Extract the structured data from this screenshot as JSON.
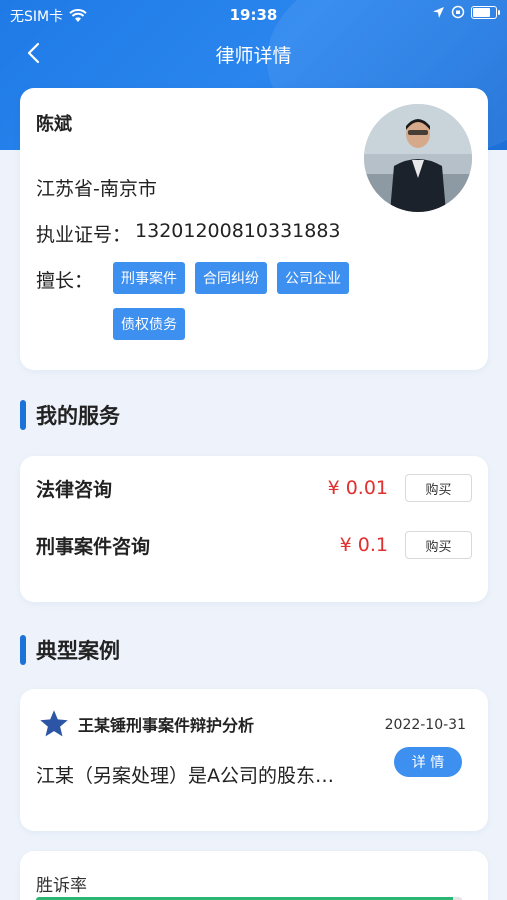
{
  "status_bar": {
    "carrier": "无SIM卡",
    "time": "19:38"
  },
  "nav": {
    "title": "律师详情"
  },
  "profile": {
    "name": "陈斌",
    "location": "江苏省-南京市",
    "license_label": "执业证号：",
    "license_number": "13201200810331883",
    "specialty_label": "擅长：",
    "specialties": [
      "刑事案件",
      "合同纠纷",
      "公司企业",
      "债权债务"
    ]
  },
  "services_section": {
    "title": "我的服务",
    "items": [
      {
        "name": "法律咨询",
        "price": "¥ 0.01",
        "button": "购买"
      },
      {
        "name": "刑事案件咨询",
        "price": "¥ 0.1",
        "button": "购买"
      }
    ]
  },
  "cases_section": {
    "title": "典型案例",
    "items": [
      {
        "title": "王某锤刑事案件辩护分析",
        "date": "2022-10-31",
        "description": "江某（另案处理）是A公司的股东…",
        "button": "详 情"
      }
    ]
  },
  "win_rate": {
    "label": "胜诉率",
    "fill_fraction": 0.98
  },
  "colors": {
    "header_blue": "#1f7ae6",
    "tag_blue": "#3d8ff0",
    "price_red": "#e03030",
    "accent_bar": "#1d72d8",
    "win_rate_green": "#2ab573"
  }
}
